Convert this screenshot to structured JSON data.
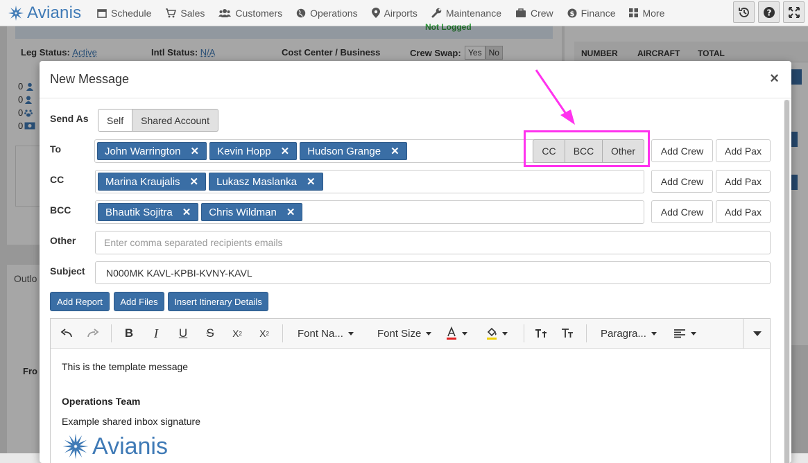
{
  "nav": {
    "brand": "Avianis",
    "items": [
      "Schedule",
      "Sales",
      "Customers",
      "Operations",
      "Airports",
      "Maintenance",
      "Crew",
      "Finance",
      "More"
    ]
  },
  "background": {
    "leg_status_label": "Leg Status:",
    "leg_status_value": "Active",
    "intl_status_label": "Intl Status:",
    "intl_status_value": "N/A",
    "cost_center_label": "Cost Center / Business",
    "crew_swap_label": "Crew Swap:",
    "crew_swap_yes": "Yes",
    "crew_swap_no": "No",
    "not_logged": "Not Logged",
    "table_headers": [
      "NUMBER",
      "AIRCRAFT",
      "TOTAL"
    ],
    "counts": [
      "0",
      "0",
      "0",
      "0"
    ],
    "tab_outlook": "Outlo",
    "from_label": "Fro"
  },
  "modal": {
    "title": "New Message",
    "close": "×",
    "send_as_label": "Send As",
    "send_as_options": [
      "Self",
      "Shared Account"
    ],
    "to_label": "To",
    "to_recipients": [
      "John Warrington",
      "Kevin Hopp",
      "Hudson Grange"
    ],
    "cc_label": "CC",
    "cc_recipients": [
      "Marina Kraujalis",
      "Lukasz Maslanka"
    ],
    "bcc_label": "BCC",
    "bcc_recipients": [
      "Bhautik Sojitra",
      "Chris Wildman"
    ],
    "toggle_buttons": [
      "CC",
      "BCC",
      "Other"
    ],
    "add_crew": "Add Crew",
    "add_pax": "Add Pax",
    "other_label": "Other",
    "other_placeholder": "Enter comma separated recipients emails",
    "subject_label": "Subject",
    "subject_value": "N000MK KAVL-KPBI-KVNY-KAVL",
    "add_report": "Add Report",
    "add_files": "Add Files",
    "insert_itinerary": "Insert Itinerary Details",
    "toolbar": {
      "font_name": "Font Na...",
      "font_size": "Font Size",
      "paragraph": "Paragra..."
    },
    "body": {
      "line1": "This is the template message",
      "team": "Operations Team",
      "signature": "Example shared inbox signature",
      "logo_text": "Avianis"
    }
  },
  "colors": {
    "tag_blue": "#3a6ea5",
    "brand_blue": "#3f7ab6",
    "highlight": "#ff33ee"
  }
}
